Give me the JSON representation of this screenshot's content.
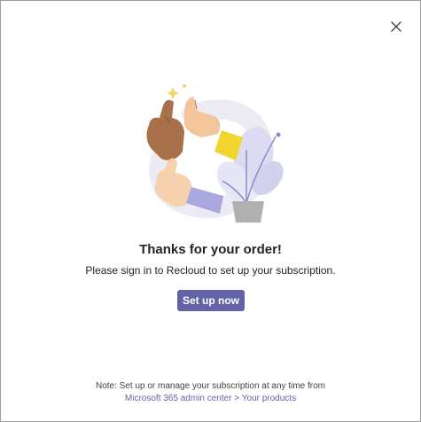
{
  "dialog": {
    "title": "Thanks for your order!",
    "message": "Please sign in to Recloud to set up your subscription.",
    "primary_button": "Set up now",
    "note": "Note: Set up or manage your subscription at any time from",
    "link": "Microsoft 365 admin center > Your products",
    "close_icon": "close-icon",
    "accent_color": "#6264a7"
  }
}
